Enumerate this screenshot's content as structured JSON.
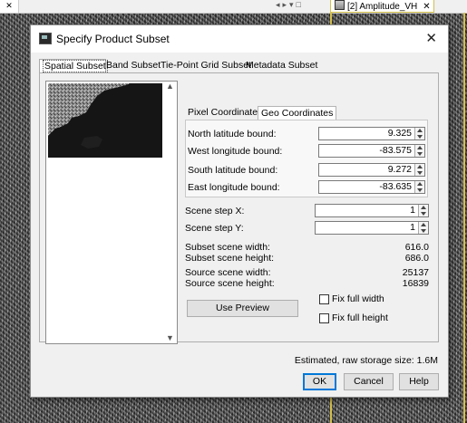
{
  "background_tab": {
    "label": "[2] Amplitude_VH",
    "close": "✕"
  },
  "dialog": {
    "title": "Specify Product Subset",
    "close": "✕",
    "tabs": [
      "Spatial Subset",
      "Band Subset",
      "Tie-Point Grid Subset",
      "Metadata Subset"
    ],
    "inner_tabs": [
      "Pixel Coordinates",
      "Geo Coordinates"
    ],
    "geo": {
      "north_label": "North latitude bound:",
      "north_value": "9.325",
      "west_label": "West longitude bound:",
      "west_value": "-83.575",
      "south_label": "South latitude bound:",
      "south_value": "9.272",
      "east_label": "East longitude bound:",
      "east_value": "-83.635"
    },
    "scene_step_x_label": "Scene step X:",
    "scene_step_x_value": "1",
    "scene_step_y_label": "Scene step Y:",
    "scene_step_y_value": "1",
    "subset_width_label": "Subset scene width:",
    "subset_width_value": "616.0",
    "subset_height_label": "Subset scene height:",
    "subset_height_value": "686.0",
    "source_width_label": "Source scene width:",
    "source_width_value": "25137",
    "source_height_label": "Source scene height:",
    "source_height_value": "16839",
    "use_preview_label": "Use Preview",
    "fix_width_label": "Fix full width",
    "fix_height_label": "Fix full height",
    "storage_label": "Estimated, raw storage size: 1.6M",
    "ok_label": "OK",
    "cancel_label": "Cancel",
    "help_label": "Help"
  }
}
